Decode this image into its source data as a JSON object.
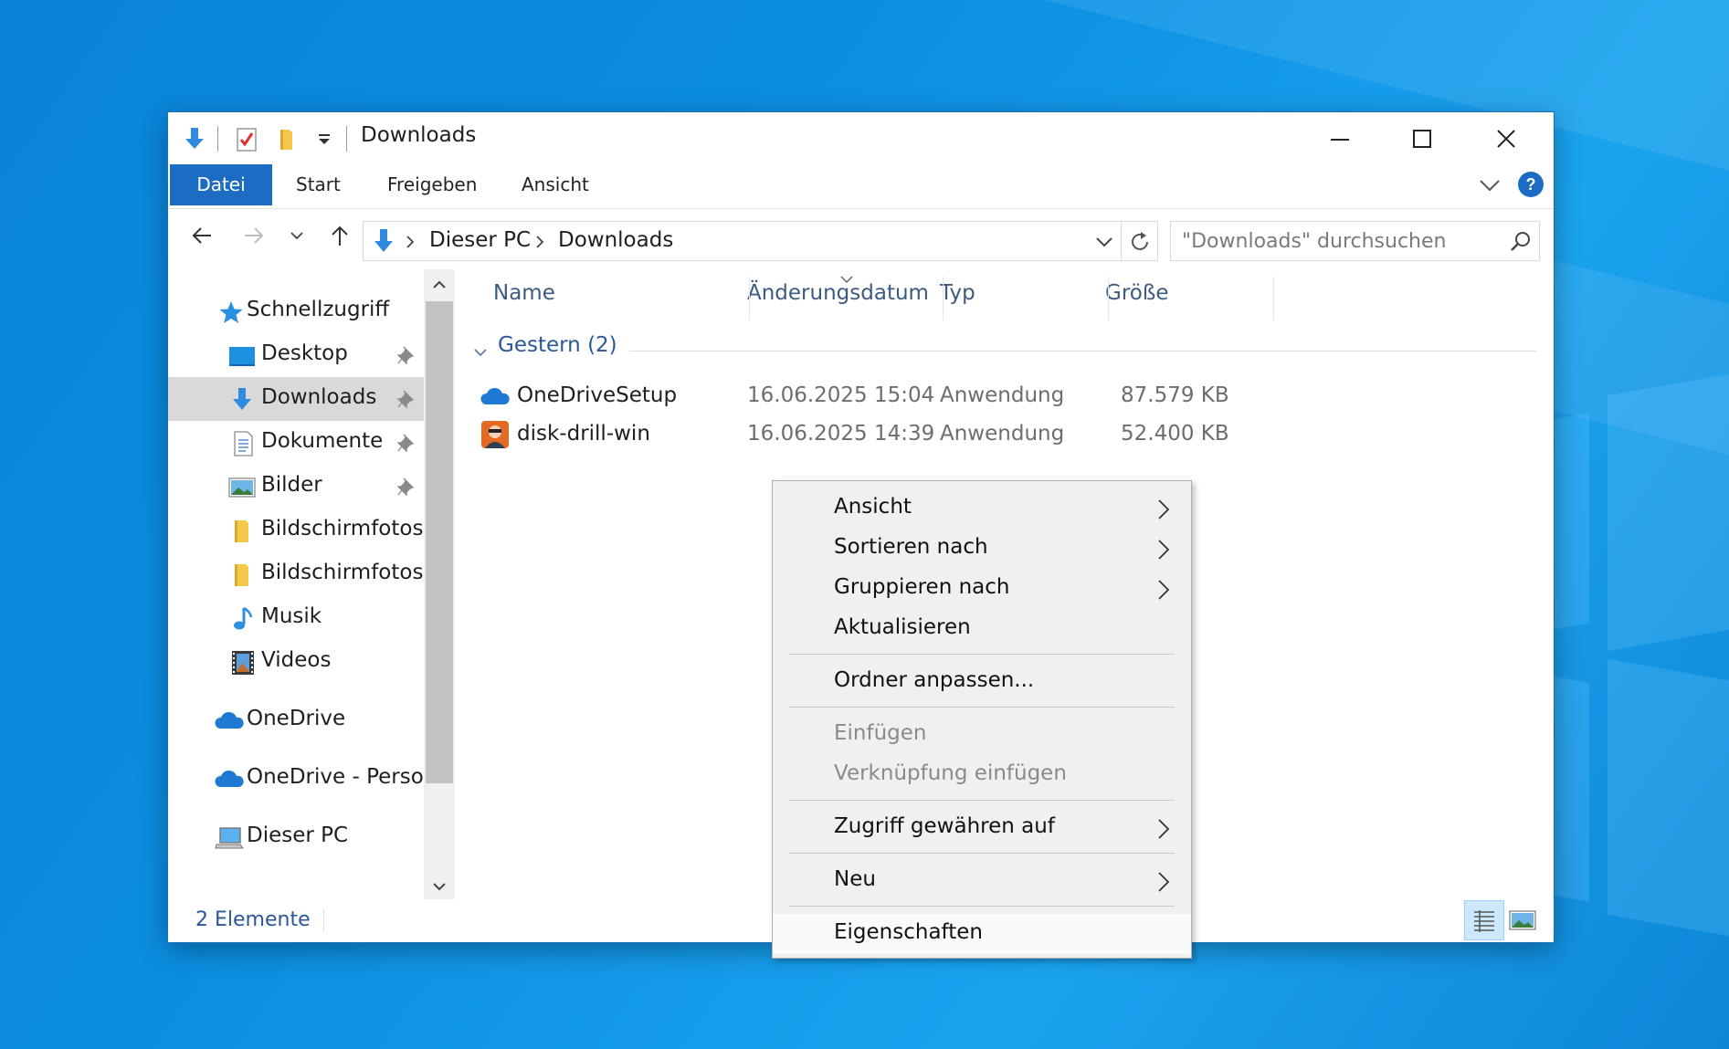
{
  "window": {
    "title": "Downloads",
    "ribbon_tabs": [
      "Datei",
      "Start",
      "Freigeben",
      "Ansicht"
    ],
    "accent_color": "#1c6cc4"
  },
  "address": {
    "crumbs": [
      "Dieser PC",
      "Downloads"
    ],
    "search_placeholder": "\"Downloads\" durchsuchen"
  },
  "nav": {
    "quick_access": "Schnellzugriff",
    "items": [
      {
        "label": "Desktop",
        "icon": "desktop-icon",
        "pinned": true
      },
      {
        "label": "Downloads",
        "icon": "download-icon",
        "pinned": true,
        "selected": true
      },
      {
        "label": "Dokumente",
        "icon": "document-icon",
        "pinned": true
      },
      {
        "label": "Bilder",
        "icon": "pictures-icon",
        "pinned": true
      },
      {
        "label": "Bildschirmfotos",
        "icon": "folder-icon",
        "pinned": false
      },
      {
        "label": "Bildschirmfotos",
        "icon": "folder-icon",
        "pinned": false
      },
      {
        "label": "Musik",
        "icon": "music-icon",
        "pinned": false
      },
      {
        "label": "Videos",
        "icon": "video-icon",
        "pinned": false
      }
    ],
    "onedrive": "OneDrive",
    "onedrive_personal": "OneDrive - Person",
    "this_pc": "Dieser PC"
  },
  "columns": {
    "name": "Name",
    "date": "Änderungsdatum",
    "type": "Typ",
    "size": "Größe"
  },
  "group": {
    "label": "Gestern (2)"
  },
  "files": [
    {
      "name": "OneDriveSetup",
      "date": "16.06.2025 15:04",
      "type": "Anwendung",
      "size": "87.579 KB",
      "icon": "onedrive-icon"
    },
    {
      "name": "disk-drill-win",
      "date": "16.06.2025 14:39",
      "type": "Anwendung",
      "size": "52.400 KB",
      "icon": "disk-drill-icon"
    }
  ],
  "status": {
    "count": "2 Elemente"
  },
  "context_menu": {
    "ansicht": "Ansicht",
    "sortieren": "Sortieren nach",
    "gruppieren": "Gruppieren nach",
    "aktualisieren": "Aktualisieren",
    "ordner": "Ordner anpassen...",
    "einfuegen": "Einfügen",
    "verknuepfung": "Verknüpfung einfügen",
    "zugriff": "Zugriff gewähren auf",
    "neu": "Neu",
    "eigenschaften": "Eigenschaften"
  }
}
